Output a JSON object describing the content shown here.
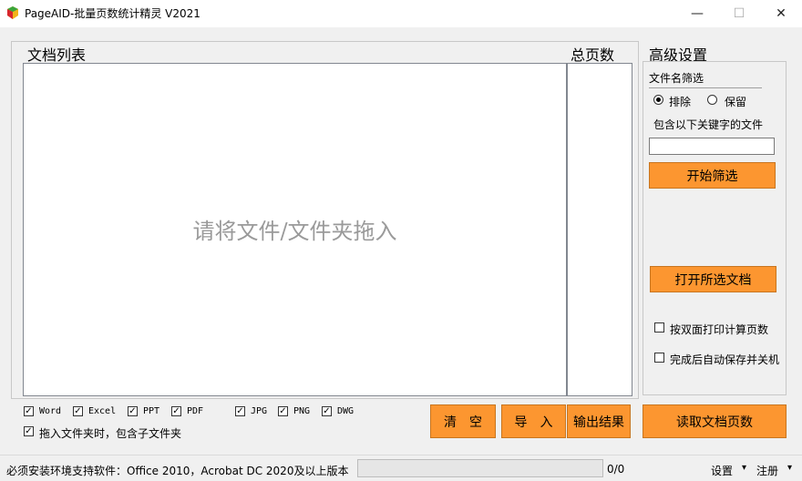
{
  "window": {
    "title": "PageAID-批量页数统计精灵 V2021",
    "minimize_glyph": "—",
    "maximize_glyph": "☐",
    "close_glyph": "✕"
  },
  "doc_list": {
    "header": "文档列表",
    "placeholder": "请将文件/文件夹拖入"
  },
  "page_count": {
    "header": "总页数"
  },
  "advanced": {
    "header": "高级设置",
    "filename_filter_label": "文件名筛选",
    "radio_exclude": "排除",
    "radio_keep": "保留",
    "selected_mode": "exclude",
    "keyword_label": "包含以下关键字的文件",
    "keyword_value": "",
    "start_filter_button": "开始筛选",
    "open_selected_button": "打开所选文档",
    "duplex_option": "按双面打印计算页数",
    "shutdown_option": "完成后自动保存并关机"
  },
  "file_types": [
    {
      "label": "Word",
      "checked": true
    },
    {
      "label": "Excel",
      "checked": true
    },
    {
      "label": "PPT",
      "checked": true
    },
    {
      "label": "PDF",
      "checked": true
    },
    {
      "label": "JPG",
      "checked": true
    },
    {
      "label": "PNG",
      "checked": true
    },
    {
      "label": "DWG",
      "checked": true
    }
  ],
  "include_subfolders": {
    "label": "拖入文件夹时，包含子文件夹",
    "checked": true
  },
  "buttons": {
    "clear": "清　空",
    "import": "导　入",
    "export": "输出结果",
    "read_pages": "读取文档页数"
  },
  "status": {
    "requirement_text": "必须安装环境支持软件：Office 2010，Acrobat DC 2020及以上版本",
    "progress": 0,
    "counter": "0/0",
    "settings_menu": "设置",
    "register_menu": "注册",
    "dropdown_glyph": "▾"
  },
  "colors": {
    "accent_orange": "#fc9630"
  }
}
